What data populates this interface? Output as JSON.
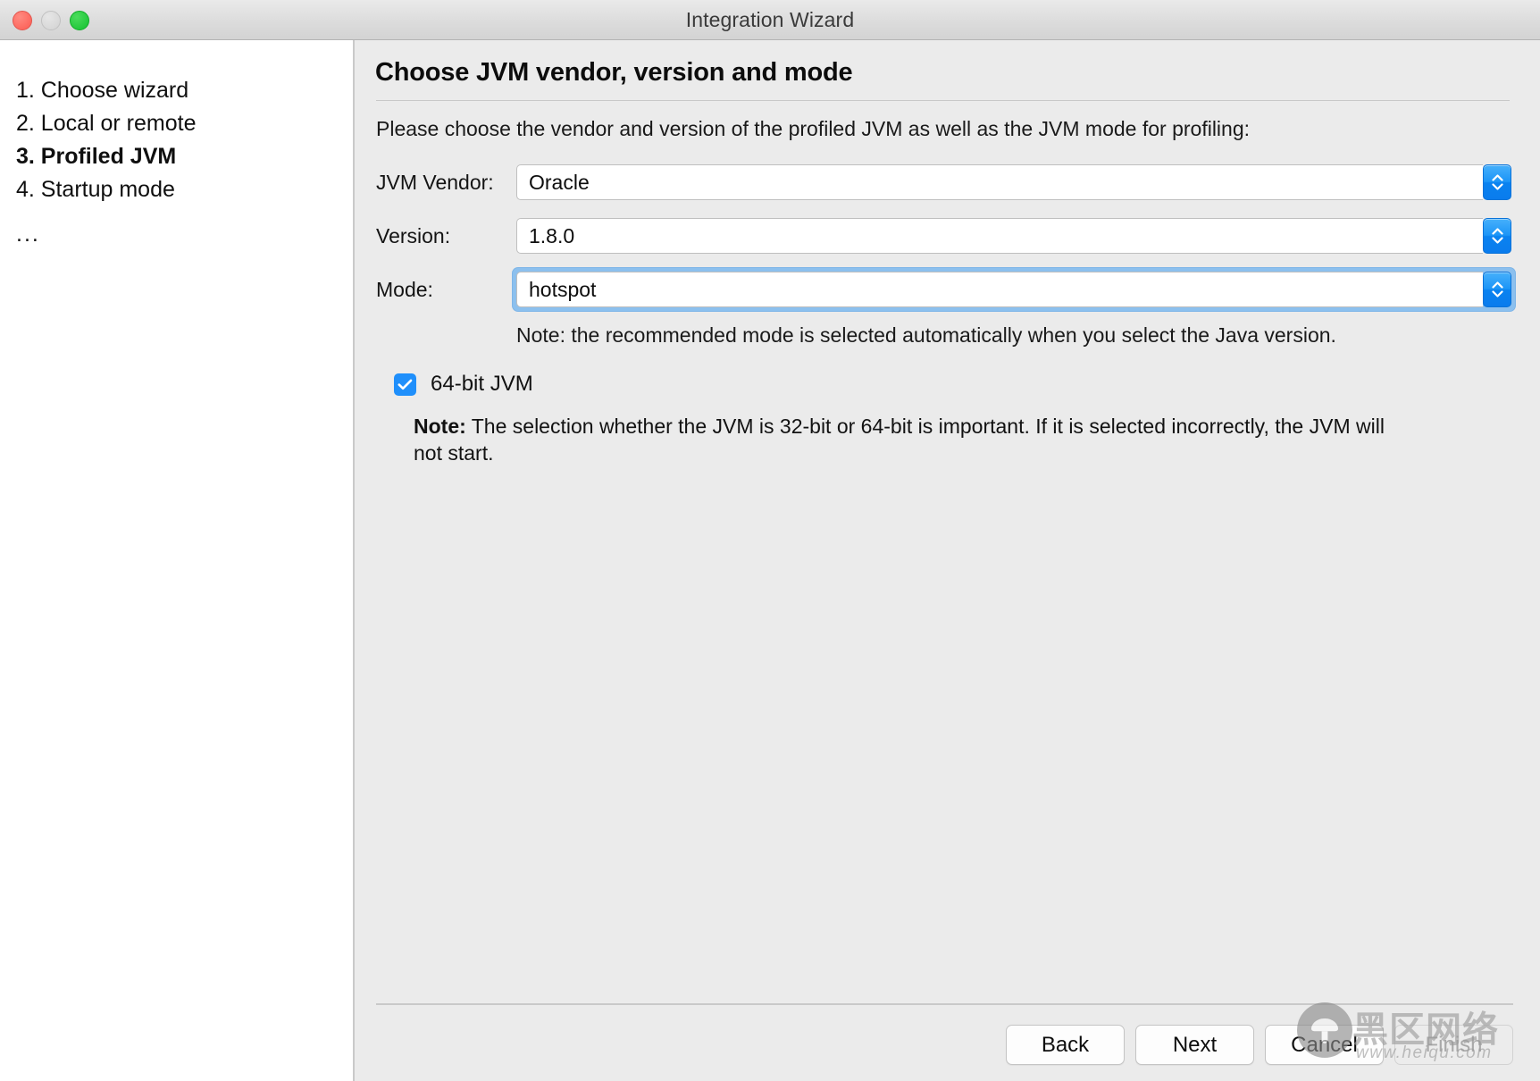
{
  "window": {
    "title": "Integration Wizard",
    "controls": {
      "close": "close-button",
      "minimize": "minimize-button",
      "zoom": "zoom-button"
    }
  },
  "sidebar": {
    "steps": [
      {
        "label": "1. Choose wizard",
        "current": false
      },
      {
        "label": "2. Local or remote",
        "current": false
      },
      {
        "label": "3. Profiled JVM",
        "current": true
      },
      {
        "label": "4. Startup mode",
        "current": false
      }
    ],
    "more": "..."
  },
  "main": {
    "page_title": "Choose JVM vendor, version and mode",
    "intro": "Please choose the vendor and version of the profiled JVM as well as the JVM mode for profiling:",
    "fields": [
      {
        "label": "JVM Vendor:",
        "value": "Oracle",
        "focused": false
      },
      {
        "label": "Version:",
        "value": "1.8.0",
        "focused": false
      },
      {
        "label": "Mode:",
        "value": "hotspot",
        "focused": true
      }
    ],
    "mode_note": "Note: the recommended mode is selected automatically when you select the Java version.",
    "checkbox": {
      "label": "64-bit JVM",
      "checked": true
    },
    "bit_note_prefix": "Note:",
    "bit_note": " The selection whether the JVM is 32-bit or 64-bit is important. If it is selected incorrectly, the JVM will not start."
  },
  "footer": {
    "buttons": [
      {
        "label": "Back",
        "disabled": false
      },
      {
        "label": "Next",
        "disabled": false
      },
      {
        "label": "Cancel",
        "disabled": false
      },
      {
        "label": "Finish",
        "disabled": true
      }
    ]
  },
  "watermark": {
    "cn": "黑区网络",
    "url": "www.heiqu.com"
  },
  "colors": {
    "accent_blue": "#1f8ffb",
    "focus_ring": "#8cc0ee",
    "panel_bg": "#ebebeb",
    "sidebar_bg": "#ffffff",
    "titlebar_bg": "#dcdcdc"
  }
}
